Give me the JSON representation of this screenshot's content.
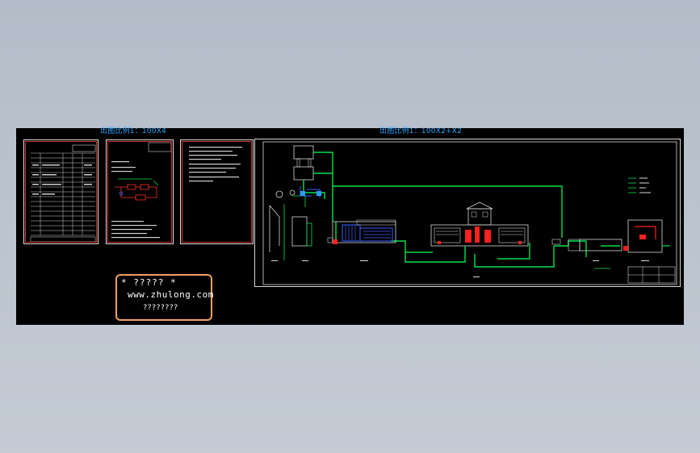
{
  "captions": {
    "left_scale": "出图比例1：100X4",
    "right_scale": "出图比例1：100X2+X2"
  },
  "watermark": {
    "line1": "* ????? *",
    "line2": "www.zhulong.com",
    "line3": "????????"
  },
  "colors": {
    "canvas": "#000000",
    "background": "#b8c0cc",
    "pipe_green": "#00e04a",
    "tank_blue": "#3a60ff",
    "accent_red": "#ff2020",
    "caption_blue": "#2aa7ff",
    "watermark_border": "#f0a060"
  }
}
